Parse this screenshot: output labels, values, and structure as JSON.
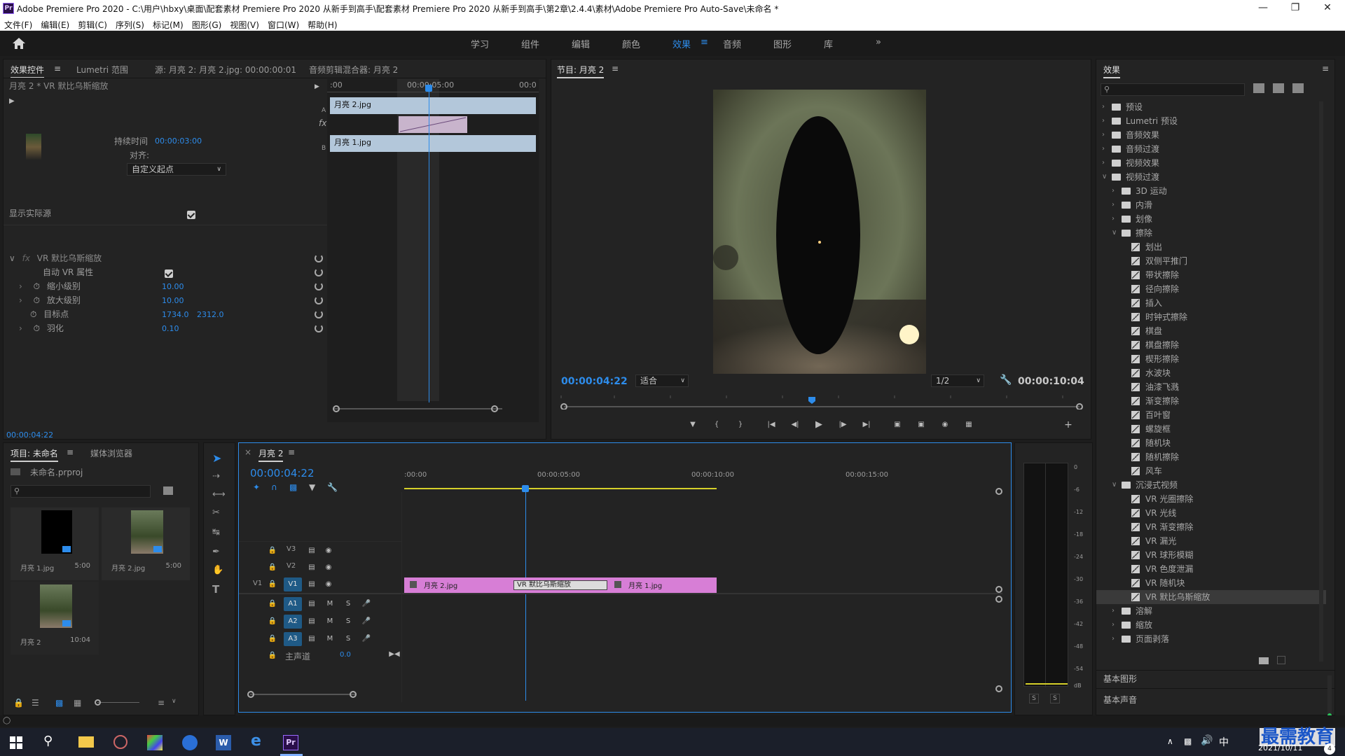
{
  "window": {
    "title": "Adobe Premiere Pro 2020 - C:\\用户\\hbxy\\桌面\\配套素材 Premiere Pro 2020 从新手到高手\\配套素材 Premiere Pro 2020 从新手到高手\\第2章\\2.4.4\\素材\\Adobe Premiere Pro Auto-Save\\未命名 *",
    "app_icon": "Pr"
  },
  "menu": [
    "文件(F)",
    "编辑(E)",
    "剪辑(C)",
    "序列(S)",
    "标记(M)",
    "图形(G)",
    "视图(V)",
    "窗口(W)",
    "帮助(H)"
  ],
  "workspaces": [
    "学习",
    "组件",
    "编辑",
    "颜色",
    "效果",
    "音频",
    "图形",
    "库"
  ],
  "active_workspace": "效果",
  "effect_controls": {
    "tabs": [
      "效果控件",
      "Lumetri 范围",
      "源: 月亮 2: 月亮 2.jpg: 00:00:00:01",
      "音频剪辑混合器: 月亮 2"
    ],
    "clip_header": "月亮 2 * VR 默比乌斯缩放",
    "duration_label": "持续时间",
    "duration_value": "00:00:03:00",
    "align_label": "对齐:",
    "align_value": "自定义起点",
    "show_source_label": "显示实际源",
    "effect_name": "VR 默比乌斯缩放",
    "params": [
      {
        "label": "自动 VR 属性",
        "value": ""
      },
      {
        "label": "缩小级别",
        "value": "10.00"
      },
      {
        "label": "放大级别",
        "value": "10.00"
      },
      {
        "label": "目标点",
        "value": "1734.0",
        "value2": "2312.0"
      },
      {
        "label": "羽化",
        "value": "0.10"
      }
    ],
    "timecode": "00:00:04:22",
    "ruler": [
      ":00",
      "00:00:05:00",
      "00:0"
    ],
    "track_a_clip": "月亮 2.jpg",
    "track_b_clip": "月亮 1.jpg",
    "track_a_label": "A",
    "track_b_label": "B",
    "fx_label": "fx"
  },
  "program": {
    "title": "节目: 月亮 2",
    "timecode": "00:00:04:22",
    "fit": "适合",
    "resolution": "1/2",
    "duration": "00:00:10:04"
  },
  "effects_panel": {
    "title": "效果",
    "tree": [
      {
        "label": "预设",
        "level": 0,
        "type": "folder",
        "open": false
      },
      {
        "label": "Lumetri 预设",
        "level": 0,
        "type": "folder",
        "open": false
      },
      {
        "label": "音频效果",
        "level": 0,
        "type": "folder",
        "open": false
      },
      {
        "label": "音频过渡",
        "level": 0,
        "type": "folder",
        "open": false
      },
      {
        "label": "视频效果",
        "level": 0,
        "type": "folder",
        "open": false
      },
      {
        "label": "视频过渡",
        "level": 0,
        "type": "folder",
        "open": true
      },
      {
        "label": "3D 运动",
        "level": 1,
        "type": "folder",
        "open": false
      },
      {
        "label": "内滑",
        "level": 1,
        "type": "folder",
        "open": false
      },
      {
        "label": "划像",
        "level": 1,
        "type": "folder",
        "open": false
      },
      {
        "label": "擦除",
        "level": 1,
        "type": "folder",
        "open": true
      },
      {
        "label": "划出",
        "level": 2,
        "type": "fx"
      },
      {
        "label": "双侧平推门",
        "level": 2,
        "type": "fx"
      },
      {
        "label": "带状擦除",
        "level": 2,
        "type": "fx"
      },
      {
        "label": "径向擦除",
        "level": 2,
        "type": "fx"
      },
      {
        "label": "插入",
        "level": 2,
        "type": "fx"
      },
      {
        "label": "时钟式擦除",
        "level": 2,
        "type": "fx"
      },
      {
        "label": "棋盘",
        "level": 2,
        "type": "fx"
      },
      {
        "label": "棋盘擦除",
        "level": 2,
        "type": "fx"
      },
      {
        "label": "楔形擦除",
        "level": 2,
        "type": "fx"
      },
      {
        "label": "水波块",
        "level": 2,
        "type": "fx"
      },
      {
        "label": "油漆飞溅",
        "level": 2,
        "type": "fx"
      },
      {
        "label": "渐变擦除",
        "level": 2,
        "type": "fx"
      },
      {
        "label": "百叶窗",
        "level": 2,
        "type": "fx"
      },
      {
        "label": "螺旋框",
        "level": 2,
        "type": "fx"
      },
      {
        "label": "随机块",
        "level": 2,
        "type": "fx"
      },
      {
        "label": "随机擦除",
        "level": 2,
        "type": "fx"
      },
      {
        "label": "风车",
        "level": 2,
        "type": "fx"
      },
      {
        "label": "沉浸式视频",
        "level": 1,
        "type": "folder",
        "open": true
      },
      {
        "label": "VR 光圈擦除",
        "level": 2,
        "type": "fx"
      },
      {
        "label": "VR 光线",
        "level": 2,
        "type": "fx"
      },
      {
        "label": "VR 渐变擦除",
        "level": 2,
        "type": "fx"
      },
      {
        "label": "VR 漏光",
        "level": 2,
        "type": "fx"
      },
      {
        "label": "VR 球形模糊",
        "level": 2,
        "type": "fx"
      },
      {
        "label": "VR 色度泄漏",
        "level": 2,
        "type": "fx"
      },
      {
        "label": "VR 随机块",
        "level": 2,
        "type": "fx"
      },
      {
        "label": "VR 默比乌斯缩放",
        "level": 2,
        "type": "fx",
        "selected": true
      },
      {
        "label": "溶解",
        "level": 1,
        "type": "folder",
        "open": false
      },
      {
        "label": "缩放",
        "level": 1,
        "type": "folder",
        "open": false
      },
      {
        "label": "页面剥落",
        "level": 1,
        "type": "folder",
        "open": false
      }
    ],
    "basic_graphics": "基本图形",
    "basic_sound": "基本声音",
    "search_placeholder": ""
  },
  "project": {
    "tabs": [
      "项目: 未命名",
      "媒体浏览器"
    ],
    "file": "未命名.prproj",
    "items": [
      {
        "name": "月亮 1.jpg",
        "duration": "5:00"
      },
      {
        "name": "月亮 2.jpg",
        "duration": "5:00"
      },
      {
        "name": "月亮 2",
        "duration": "10:04"
      }
    ]
  },
  "timeline": {
    "tab": "月亮 2",
    "timecode": "00:00:04:22",
    "ruler": [
      ":00:00",
      "00:00:05:00",
      "00:00:10:00",
      "00:00:15:00"
    ],
    "tracks_video": [
      "V3",
      "V2",
      "V1"
    ],
    "tracks_audio": [
      "A1",
      "A2",
      "A3"
    ],
    "source_patch": "V1",
    "master": {
      "label": "主声道",
      "value": "0.0"
    },
    "clip1": "月亮 2.jpg",
    "transition": "VR 默比乌斯缩放",
    "clip2": "月亮 1.jpg",
    "mute": "M",
    "solo": "S"
  },
  "audio_meter": {
    "scale": [
      "0",
      "-6",
      "-12",
      "-18",
      "-24",
      "-30",
      "-36",
      "-42",
      "-48",
      "-54",
      "dB"
    ],
    "buttons": [
      "S",
      "S"
    ]
  },
  "taskbar": {
    "ime": "中",
    "date": "2021/10/11",
    "watermark": "最需教育",
    "badge": "4"
  }
}
